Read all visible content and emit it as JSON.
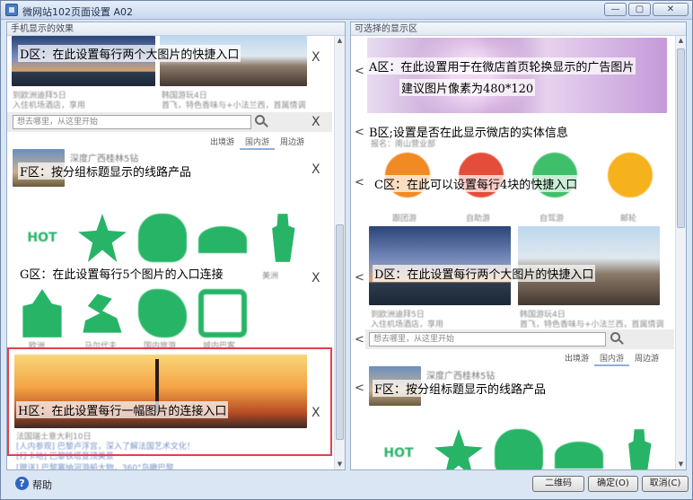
{
  "window": {
    "title": "微网站102页面设置 A02"
  },
  "left_panel": {
    "title": "手机显示的效果",
    "annotations": {
      "d": "D区：在此设置每行两个大图片的快捷入口",
      "f": "F区：按分组标题显示的线路产品",
      "g": "G区：在此设置每行5个图片的入口连接",
      "h": "H区：在此设置每行一幅图片的连接入口"
    },
    "close_glyph": "X",
    "search_placeholder": "想去哪里，从这里开始",
    "tabs": [
      "出境游",
      "国内游",
      "周边游"
    ],
    "blurred": {
      "d_caption_left": "到欧洲迪拜5日",
      "d_caption_left_sub": "入住机场酒店，享用",
      "d_caption_right": "韩国游玩4日",
      "d_caption_right_sub": "首飞，特色香味与+小法兰西，首属情调",
      "tour_title": "深度广西桂林5钻",
      "hot_label": "HOT",
      "g_label_5": "美洲",
      "g_labels_row2": [
        "欧洲",
        "马尔代夫",
        "国内旅游",
        "城内巴客"
      ],
      "h_title": "法国瑞士意大利10日",
      "h_line1": "[人内参观] 巴黎卢浮宫，深入了解法国艺术文化！",
      "h_line2": "[打卡地] 巴黎铁塔登顶美景",
      "footer_line": "[赠送] 巴黎塞纳河游船大物，360°鸟瞰巴黎"
    }
  },
  "right_panel": {
    "title": "可选择的显示区",
    "annotations": {
      "a_line1": "A区：在此设置用于在微店首页轮换显示的广告图片",
      "a_line2": "建议图片像素为480*120",
      "b": "B区;设置是否在此显示微店的实体信息",
      "c": "C区：在此可以设置每行4块的快捷入口",
      "d": "D区：在此设置每行两个大图片的快捷入口",
      "f": "F区：按分组标题显示的线路产品"
    },
    "arrow_glyph": "<",
    "search_placeholder": "想去哪里，从这里开始",
    "tabs": [
      "出境游",
      "国内游",
      "周边游"
    ],
    "blurred": {
      "b_line": "报名：南山营业部",
      "c_labels": [
        "跟团游",
        "自助游",
        "自驾游",
        "邮轮"
      ],
      "d_caption_left": "到欧洲迪拜5日",
      "d_caption_left_sub": "入住机场酒店，享用",
      "d_caption_right": "韩国游玩4日",
      "d_caption_right_sub": "首飞，特色香味与+小法兰西，首属情调",
      "tour_title": "深度广西桂林5钻",
      "hot_label": "HOT"
    }
  },
  "footer": {
    "help_label": "帮助",
    "qrcode_button": "二维码",
    "ok_button": "确定(O)",
    "cancel_button": "取消(C)"
  },
  "window_buttons": {
    "minimize": "—",
    "maximize": "▢",
    "close": "✕"
  }
}
